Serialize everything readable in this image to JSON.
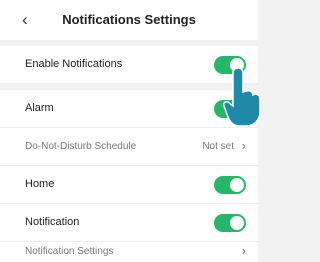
{
  "header": {
    "back_icon": "chevron-left-icon",
    "title": "Notifications Settings"
  },
  "rows": {
    "enable": {
      "label": "Enable Notifications",
      "on": true
    },
    "alarm": {
      "label": "Alarm",
      "on": true
    },
    "dnd": {
      "label": "Do-Not-Disturb Schedule",
      "value": "Not set"
    },
    "home": {
      "label": "Home",
      "on": true
    },
    "notification": {
      "label": "Notification",
      "on": true
    },
    "notif_settings": {
      "label": "Notification Settings"
    }
  },
  "colors": {
    "toggle_on": "#26b768",
    "accent_line": "#e8a040"
  }
}
